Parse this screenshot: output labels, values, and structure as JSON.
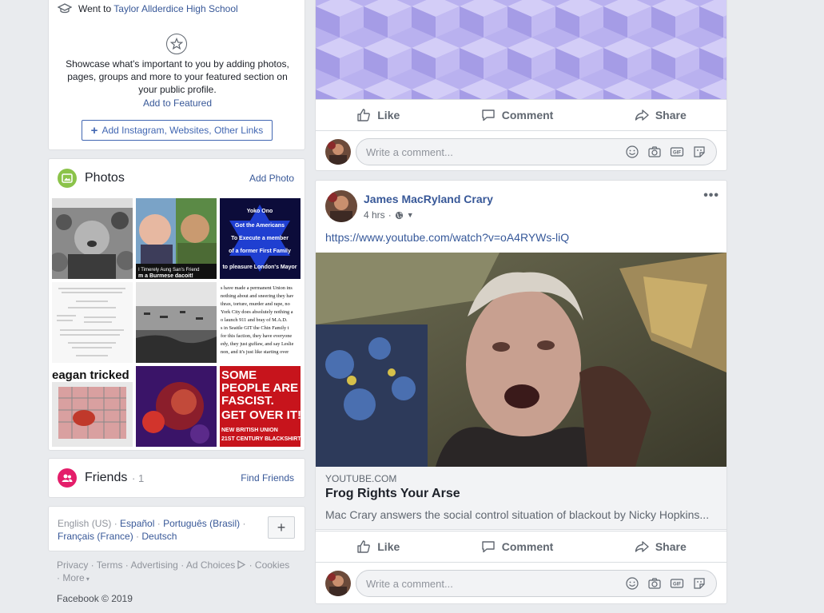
{
  "intro": {
    "went_to_prefix": "Went to",
    "school": "Taylor Allderdice High School",
    "showcase_text": "Showcase what's important to you by adding photos, pages, groups and more to your featured section on your public profile.",
    "add_featured": "Add to Featured",
    "add_links": "Add Instagram, Websites, Other Links"
  },
  "photos": {
    "title": "Photos",
    "add_photo": "Add Photo",
    "tiles": [
      {
        "caption": ""
      },
      {
        "caption": "I Timerely Aung San's Friend... m a Burmese dacoit!"
      },
      {
        "caption": "Yoko Ono Got the Americans To Execute a member of a former First Family to pleasure London's Mayor"
      },
      {
        "caption": ""
      },
      {
        "caption": ""
      },
      {
        "caption": "s have made a permanent Union ins nothing about and sneering they hav thrax, torture, murder and rape, no York City does absolutely nothing a o launch 911 and bray of M.A.D. for this faction, they have everyone i edy, they just guffaw, and say Leslie non, and it's just like starting over, the"
      },
      {
        "caption": "eagan tricked"
      },
      {
        "caption": ""
      },
      {
        "caption": "SOME PEOPLE ARE FASCIST. GET OVER IT! NEW BRITISH UNION 21ST CENTURY BLACKSHIRTS"
      }
    ]
  },
  "friends": {
    "title": "Friends",
    "count": "· 1",
    "find": "Find Friends"
  },
  "languages": {
    "current": "English (US)",
    "others": [
      "Español",
      "Português (Brasil)",
      "Français (France)",
      "Deutsch"
    ],
    "sep": " · "
  },
  "footer": {
    "links": [
      "Privacy",
      "Terms",
      "Advertising",
      "Ad Choices",
      "Cookies",
      "More"
    ],
    "copyright": "Facebook © 2019"
  },
  "actions": {
    "like": "Like",
    "comment": "Comment",
    "share": "Share",
    "comment_placeholder": "Write a comment..."
  },
  "post2": {
    "author": "James MacRyland Crary",
    "time": "4 hrs",
    "url": "https://www.youtube.com/watch?v=oA4RYWs-liQ",
    "preview_domain": "YOUTUBE.COM",
    "preview_title": "Frog Rights Your Arse",
    "preview_desc": "Mac Crary answers the social control situation of blackout by Nicky Hopkins..."
  },
  "colors": {
    "link": "#385898",
    "photos_icon": "#8bc34a",
    "friends_icon": "#e41e6a",
    "pattern": "#b8b0ee"
  }
}
